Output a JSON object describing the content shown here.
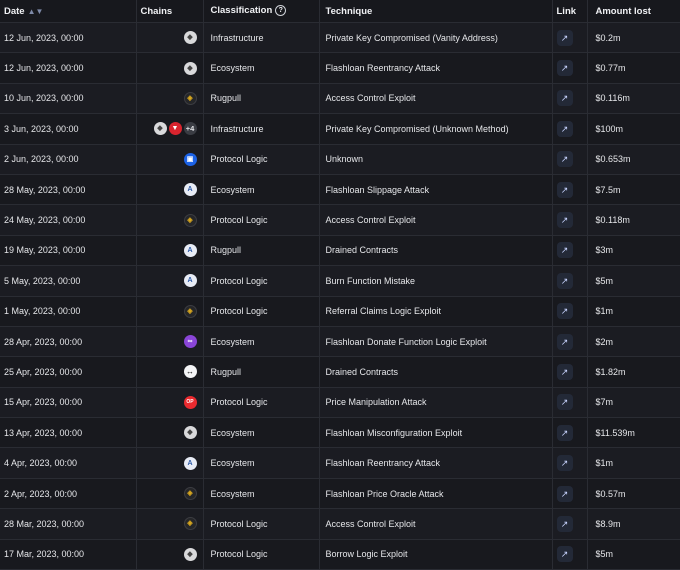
{
  "headers": {
    "date": "Date",
    "chains": "Chains",
    "classification": "Classification",
    "technique": "Technique",
    "link": "Link",
    "amount": "Amount lost"
  },
  "rows": [
    {
      "date": "12 Jun, 2023, 00:00",
      "chains": [
        "ethereum-icon"
      ],
      "classification": "Infrastructure",
      "technique": "Private Key Compromised (Vanity Address)",
      "amount": "$0.2m"
    },
    {
      "date": "12 Jun, 2023, 00:00",
      "chains": [
        "ethereum-icon"
      ],
      "classification": "Ecosystem",
      "technique": "Flashloan Reentrancy Attack",
      "amount": "$0.77m"
    },
    {
      "date": "10 Jun, 2023, 00:00",
      "chains": [
        "bnb-icon"
      ],
      "classification": "Rugpull",
      "technique": "Access Control Exploit",
      "amount": "$0.116m"
    },
    {
      "date": "3 Jun, 2023, 00:00",
      "chains": [
        "ethereum-icon",
        "tron-icon"
      ],
      "more_chains": "+4",
      "classification": "Infrastructure",
      "technique": "Private Key Compromised (Unknown Method)",
      "amount": "$100m"
    },
    {
      "date": "2 Jun, 2023, 00:00",
      "chains": [
        "fantom-icon"
      ],
      "classification": "Protocol Logic",
      "technique": "Unknown",
      "amount": "$0.653m"
    },
    {
      "date": "28 May, 2023, 00:00",
      "chains": [
        "arbitrum-icon"
      ],
      "classification": "Ecosystem",
      "technique": "Flashloan Slippage Attack",
      "amount": "$7.5m"
    },
    {
      "date": "24 May, 2023, 00:00",
      "chains": [
        "bnb-icon"
      ],
      "classification": "Protocol Logic",
      "technique": "Access Control Exploit",
      "amount": "$0.118m"
    },
    {
      "date": "19 May, 2023, 00:00",
      "chains": [
        "arbitrum-icon"
      ],
      "classification": "Rugpull",
      "technique": "Drained Contracts",
      "amount": "$3m"
    },
    {
      "date": "5 May, 2023, 00:00",
      "chains": [
        "arbitrum-icon"
      ],
      "classification": "Protocol Logic",
      "technique": "Burn Function Mistake",
      "amount": "$5m"
    },
    {
      "date": "1 May, 2023, 00:00",
      "chains": [
        "bnb-icon"
      ],
      "classification": "Protocol Logic",
      "technique": "Referral Claims Logic Exploit",
      "amount": "$1m"
    },
    {
      "date": "28 Apr, 2023, 00:00",
      "chains": [
        "polygon-icon"
      ],
      "classification": "Ecosystem",
      "technique": "Flashloan Donate Function Logic Exploit",
      "amount": "$2m"
    },
    {
      "date": "25 Apr, 2023, 00:00",
      "chains": [
        "chainlink-icon"
      ],
      "classification": "Rugpull",
      "technique": "Drained Contracts",
      "amount": "$1.82m"
    },
    {
      "date": "15 Apr, 2023, 00:00",
      "chains": [
        "optimism-icon"
      ],
      "classification": "Protocol Logic",
      "technique": "Price Manipulation Attack",
      "amount": "$7m"
    },
    {
      "date": "13 Apr, 2023, 00:00",
      "chains": [
        "ethereum-icon"
      ],
      "classification": "Ecosystem",
      "technique": "Flashloan Misconfiguration Exploit",
      "amount": "$11.539m"
    },
    {
      "date": "4 Apr, 2023, 00:00",
      "chains": [
        "arbitrum-icon"
      ],
      "classification": "Ecosystem",
      "technique": "Flashloan Reentrancy Attack",
      "amount": "$1m"
    },
    {
      "date": "2 Apr, 2023, 00:00",
      "chains": [
        "bnb-icon"
      ],
      "classification": "Ecosystem",
      "technique": "Flashloan Price Oracle Attack",
      "amount": "$0.57m"
    },
    {
      "date": "28 Mar, 2023, 00:00",
      "chains": [
        "bnb-icon"
      ],
      "classification": "Protocol Logic",
      "technique": "Access Control Exploit",
      "amount": "$8.9m"
    },
    {
      "date": "17 Mar, 2023, 00:00",
      "chains": [
        "ethereum-icon"
      ],
      "classification": "Protocol Logic",
      "technique": "Borrow Logic Exploit",
      "amount": "$5m"
    }
  ]
}
